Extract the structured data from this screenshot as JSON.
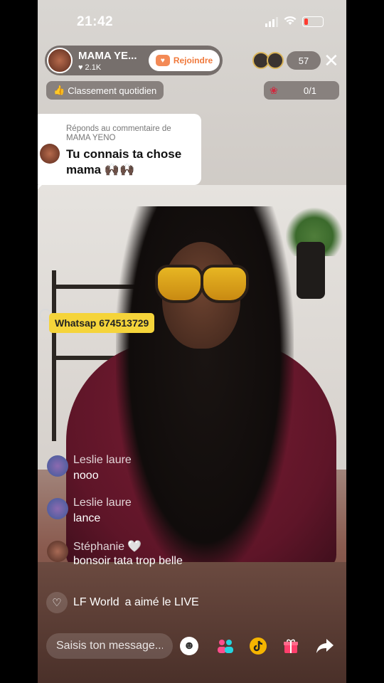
{
  "status_bar": {
    "time": "21:42"
  },
  "host": {
    "name": "MAMA YE...",
    "likes": "2.1K",
    "join_label": "Rejoindre"
  },
  "viewers": {
    "count": "57"
  },
  "ranking": {
    "label": "Classement quotidien"
  },
  "gifts": {
    "count": "0/1"
  },
  "reply_card": {
    "header": "Réponds au commentaire de MAMA YENO",
    "text": "Tu connais ta chose mama 🙌🏿🙌🏿"
  },
  "pinned_tag": {
    "text": "Whatsap 674513729"
  },
  "comments": [
    {
      "name": "Leslie laure",
      "text": "nooo"
    },
    {
      "name": "Leslie laure",
      "text": "lance"
    },
    {
      "name": "Stéphanie",
      "heart": "🤍",
      "text": "bonsoir tata trop belle"
    }
  ],
  "like_notice": {
    "user": "LF World",
    "text": "a aimé le LIVE"
  },
  "message_input": {
    "placeholder": "Saisis ton message..."
  },
  "icons": {
    "join": "join-heart-icon",
    "close": "close-icon",
    "ranking": "thumbs-up-icon",
    "gift_rose": "rose-icon",
    "like": "heart-outline-icon",
    "emoji": "emoji-icon",
    "guests": "guests-icon",
    "tiktok": "tiktok-icon",
    "gift": "gift-icon",
    "share": "share-icon"
  },
  "colors": {
    "join_accent": "#f0793b",
    "tag_yellow": "#f5d43a",
    "rose": "#d3263d"
  }
}
